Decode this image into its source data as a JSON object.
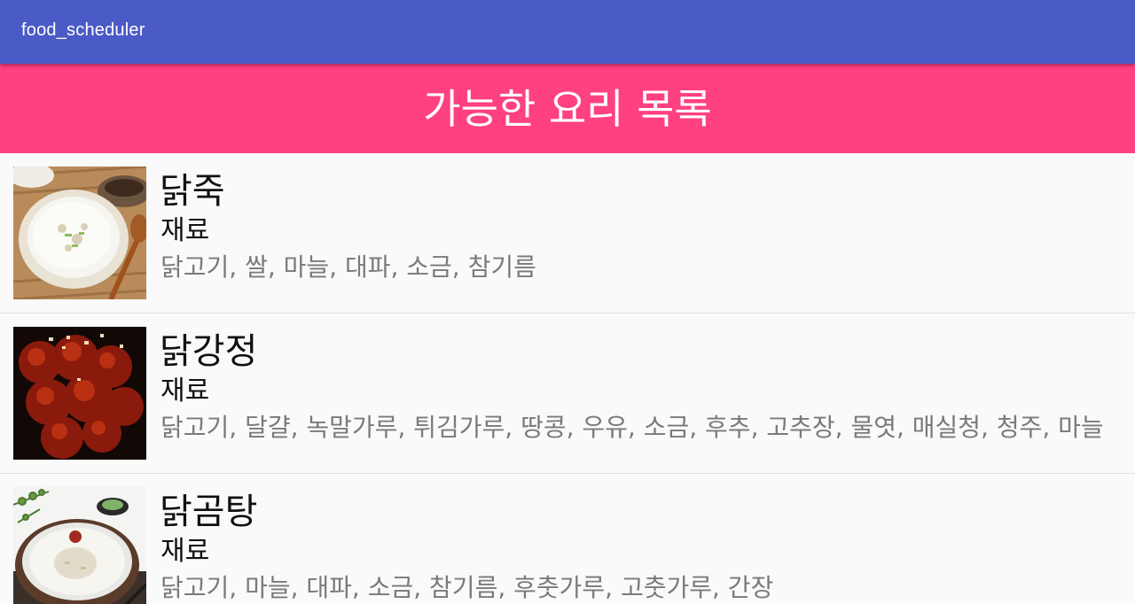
{
  "app_bar": {
    "title": "food_scheduler",
    "color": "#4a5ac6"
  },
  "header": {
    "title": "가능한 요리 목록",
    "color": "#ff4081"
  },
  "recipes": [
    {
      "name": "닭죽",
      "ingredients_label": "재료",
      "ingredients": "닭고기, 쌀, 마늘, 대파, 소금, 참기름",
      "image": "rice-porridge-photo"
    },
    {
      "name": "닭강정",
      "ingredients_label": "재료",
      "ingredients": "닭고기, 달걀, 녹말가루, 튀김가루, 땅콩, 우유, 소금, 후추, 고추장, 물엿, 매실청, 청주, 마늘",
      "image": "fried-chicken-photo"
    },
    {
      "name": "닭곰탕",
      "ingredients_label": "재료",
      "ingredients": "닭고기, 마늘, 대파, 소금, 참기름, 후춧가루, 고춧가루, 간장",
      "image": "chicken-soup-photo"
    }
  ]
}
